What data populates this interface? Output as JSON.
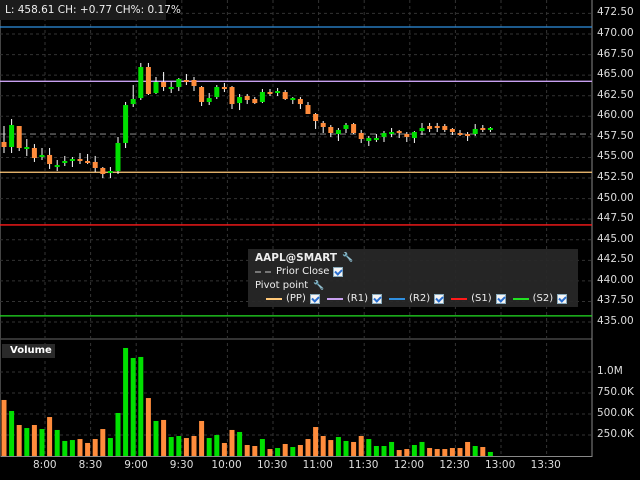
{
  "header": {
    "info": "L: 458.61 CH: +0.77 CH%: 0.17%"
  },
  "legend": {
    "symbol": "AAPL@SMART",
    "prior_close_label": "Prior Close",
    "pivot_label": "Pivot point",
    "items": [
      {
        "label": "(PP)",
        "color": "#ffc878"
      },
      {
        "label": "(R1)",
        "color": "#c8a0f0"
      },
      {
        "label": "(R2)",
        "color": "#2f8fe0"
      },
      {
        "label": "(S1)",
        "color": "#ff1a1a"
      },
      {
        "label": "(S2)",
        "color": "#22e022"
      }
    ]
  },
  "volume_label": "Volume",
  "colors": {
    "up": "#00e000",
    "down": "#ff8c3c",
    "grid": "#333333",
    "prior_close": "#666666"
  },
  "chart_data": {
    "type": "candlestick",
    "symbol": "AAPL@SMART",
    "interval_minutes": 5,
    "price_ticks": [
      "472.50",
      "470.00",
      "467.50",
      "465.00",
      "462.50",
      "460.00",
      "457.50",
      "455.00",
      "452.50",
      "450.00",
      "447.50",
      "445.00",
      "442.50",
      "440.00",
      "437.50",
      "435.00"
    ],
    "price_range": [
      433.8,
      474.1
    ],
    "volume_ticks": [
      "1.0M",
      "750.0K",
      "500.0K",
      "250.0K"
    ],
    "volume_tick_values": [
      1000000,
      750000,
      500000,
      250000
    ],
    "time_ticks": [
      "8:00",
      "8:30",
      "9:00",
      "9:30",
      "10:00",
      "10:30",
      "11:00",
      "11:30",
      "12:00",
      "12:30",
      "13:00",
      "13:30"
    ],
    "levels": {
      "R2": 470.85,
      "R1": 464.25,
      "PP": 453.2,
      "S1": 446.8,
      "S2": 435.75,
      "prior_close": 457.84
    },
    "ohlc": [
      [
        456.88,
        458.82,
        455.54,
        456.27
      ],
      [
        456.27,
        459.67,
        455.54,
        458.94
      ],
      [
        458.82,
        458.82,
        455.78,
        456.15
      ],
      [
        456.15,
        457.24,
        455.18,
        456.27
      ],
      [
        456.15,
        456.63,
        454.45,
        454.93
      ],
      [
        455.05,
        456.15,
        454.69,
        455.3
      ],
      [
        455.3,
        456.15,
        453.6,
        454.2
      ],
      [
        453.84,
        454.69,
        453.35,
        454.08
      ],
      [
        454.33,
        455.18,
        453.96,
        454.57
      ],
      [
        454.57,
        455.05,
        453.84,
        454.81
      ],
      [
        454.81,
        455.54,
        454.2,
        454.57
      ],
      [
        454.57,
        455.42,
        454.2,
        454.33
      ],
      [
        454.45,
        455.18,
        453.23,
        453.72
      ],
      [
        453.72,
        453.84,
        452.5,
        452.99
      ],
      [
        453.11,
        453.84,
        452.5,
        453.35
      ],
      [
        453.35,
        457.49,
        452.99,
        456.76
      ],
      [
        456.76,
        461.74,
        456.15,
        461.37
      ],
      [
        461.49,
        463.8,
        461.13,
        462.1
      ],
      [
        462.22,
        466.48,
        461.98,
        465.99
      ],
      [
        465.99,
        466.48,
        462.59,
        462.71
      ],
      [
        462.83,
        464.77,
        462.71,
        464.17
      ],
      [
        464.17,
        465.38,
        463.07,
        463.56
      ],
      [
        463.32,
        464.17,
        462.83,
        463.56
      ],
      [
        463.56,
        464.65,
        463.07,
        464.53
      ],
      [
        464.41,
        465.14,
        463.8,
        464.17
      ],
      [
        464.41,
        464.77,
        463.07,
        463.68
      ],
      [
        463.56,
        463.68,
        461.25,
        461.74
      ],
      [
        461.74,
        462.83,
        461.37,
        462.22
      ],
      [
        462.34,
        463.8,
        462.1,
        463.56
      ],
      [
        463.56,
        464.05,
        462.95,
        463.32
      ],
      [
        463.56,
        463.68,
        460.89,
        461.49
      ],
      [
        461.61,
        462.71,
        460.76,
        462.34
      ],
      [
        462.47,
        462.71,
        461.49,
        461.98
      ],
      [
        462.1,
        462.34,
        461.49,
        461.61
      ],
      [
        461.74,
        463.32,
        461.61,
        462.95
      ],
      [
        462.95,
        463.32,
        462.47,
        462.71
      ],
      [
        462.83,
        463.44,
        462.47,
        463.07
      ],
      [
        462.95,
        463.2,
        461.98,
        462.1
      ],
      [
        461.98,
        462.34,
        461.49,
        462.22
      ],
      [
        462.1,
        462.34,
        460.89,
        461.49
      ],
      [
        461.37,
        461.74,
        460.28,
        460.28
      ],
      [
        460.28,
        460.4,
        458.46,
        459.43
      ],
      [
        459.19,
        459.43,
        457.97,
        458.7
      ],
      [
        458.7,
        458.94,
        457.49,
        457.97
      ],
      [
        457.85,
        458.58,
        457.0,
        458.34
      ],
      [
        458.46,
        459.19,
        457.97,
        458.94
      ],
      [
        459.06,
        459.19,
        457.85,
        457.97
      ],
      [
        457.97,
        458.34,
        456.76,
        457.24
      ],
      [
        457.0,
        457.61,
        456.39,
        457.36
      ],
      [
        457.12,
        457.85,
        456.88,
        457.36
      ],
      [
        457.49,
        458.21,
        456.88,
        457.97
      ],
      [
        457.85,
        458.58,
        457.49,
        458.09
      ],
      [
        458.21,
        458.34,
        457.36,
        457.97
      ],
      [
        457.85,
        458.09,
        456.88,
        457.49
      ],
      [
        457.36,
        458.21,
        456.76,
        458.09
      ],
      [
        458.21,
        459.19,
        457.73,
        458.58
      ],
      [
        458.82,
        459.19,
        458.09,
        458.46
      ],
      [
        458.82,
        459.19,
        458.09,
        458.58
      ],
      [
        458.82,
        459.06,
        458.09,
        458.34
      ],
      [
        458.46,
        458.58,
        457.73,
        458.09
      ],
      [
        457.97,
        458.34,
        457.61,
        457.73
      ],
      [
        457.85,
        458.09,
        457.0,
        457.61
      ],
      [
        457.85,
        459.06,
        457.61,
        458.46
      ],
      [
        458.58,
        458.94,
        458.09,
        458.34
      ],
      [
        458.34,
        458.7,
        458.09,
        458.58
      ]
    ],
    "volume": [
      667000,
      536000,
      369000,
      333000,
      369000,
      321000,
      464000,
      310000,
      179000,
      190000,
      202000,
      155000,
      202000,
      321000,
      214000,
      512000,
      1286000,
      1167000,
      1179000,
      690000,
      417000,
      429000,
      226000,
      238000,
      214000,
      238000,
      417000,
      214000,
      250000,
      155000,
      310000,
      286000,
      131000,
      119000,
      202000,
      83000,
      95000,
      143000,
      107000,
      131000,
      202000,
      345000,
      238000,
      190000,
      226000,
      179000,
      167000,
      238000,
      202000,
      119000,
      119000,
      167000,
      71000,
      83000,
      131000,
      167000,
      95000,
      83000,
      83000,
      95000,
      95000,
      167000,
      119000,
      107000,
      48000
    ]
  }
}
